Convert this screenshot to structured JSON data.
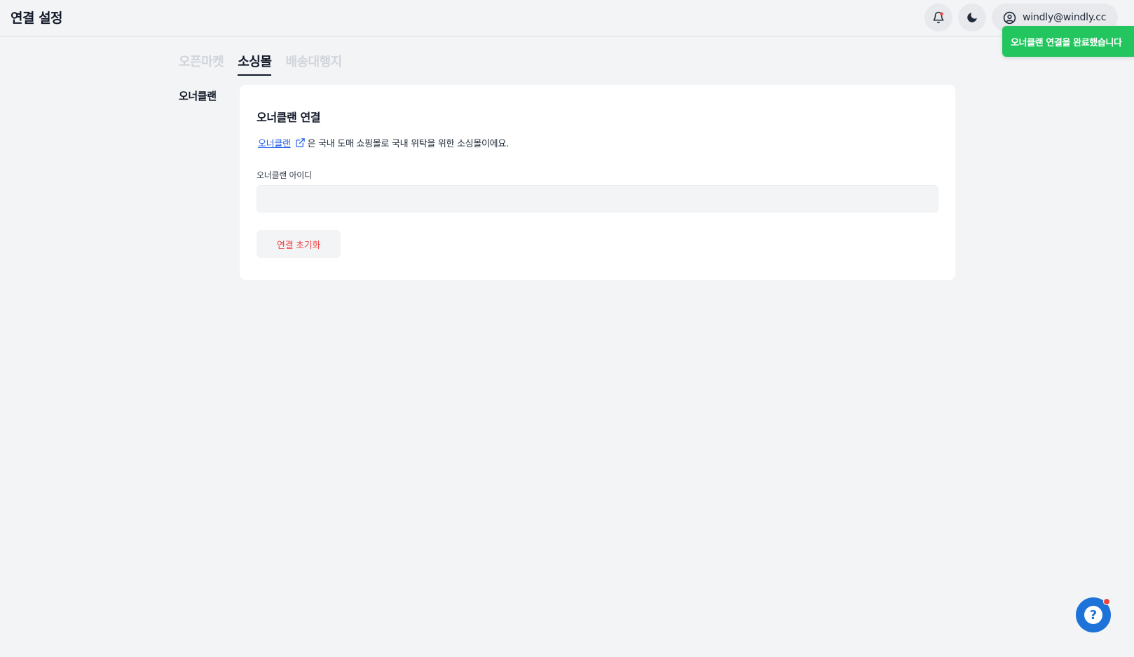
{
  "header": {
    "title": "연결 설정",
    "user_email": "windly@windly.cc"
  },
  "toast": {
    "message": "오너클랜 연결을 완료했습니다",
    "color": "#22c55e"
  },
  "tabs": [
    {
      "label": "오픈마켓",
      "active": false
    },
    {
      "label": "소싱몰",
      "active": true
    },
    {
      "label": "배송대행지",
      "active": false
    }
  ],
  "sidebar": {
    "label": "오너클랜"
  },
  "card": {
    "title": "오너클랜 연결",
    "link_text": "오너클랜",
    "description": "은 국내 도매 쇼핑몰로 국내 위탁을 위한 소싱몰이에요.",
    "field_label": "오너클랜 아이디",
    "field_value": "",
    "reset_label": "연결 초기화"
  },
  "colors": {
    "accent": "#2563eb",
    "danger": "#ef4444",
    "help_button": "#1d73d8"
  }
}
